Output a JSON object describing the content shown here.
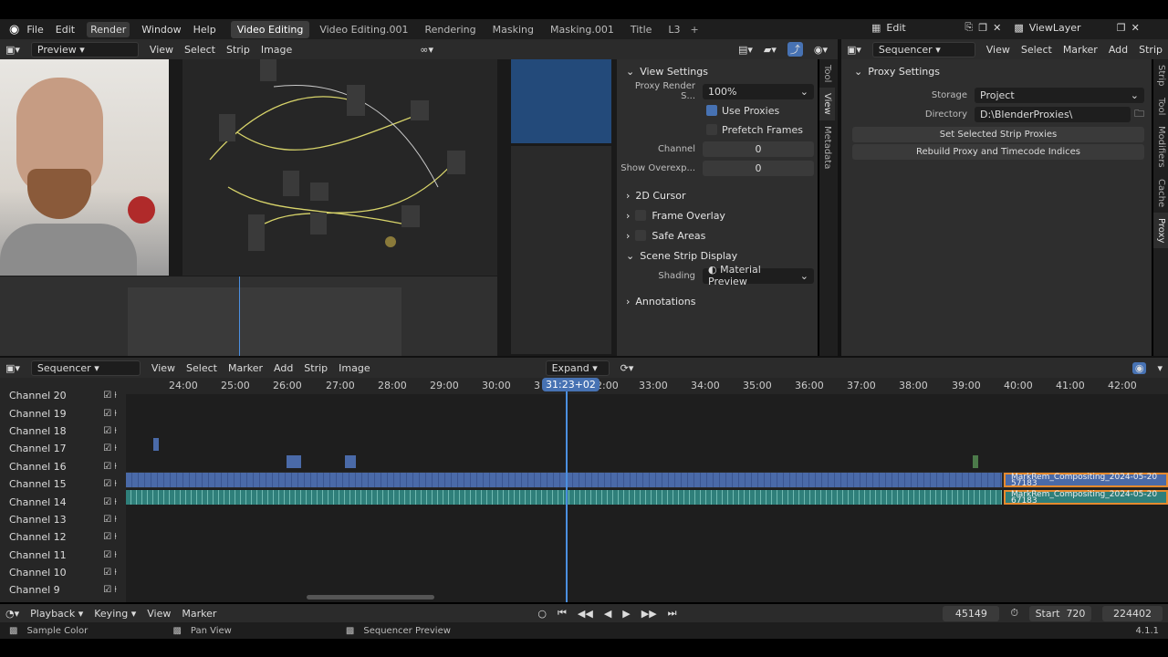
{
  "top_menu": {
    "items": [
      "File",
      "Edit",
      "Render",
      "Window",
      "Help"
    ],
    "workspaces": [
      "Video Editing",
      "Video Editing.001",
      "Rendering",
      "Masking",
      "Masking.001",
      "Title",
      "L3"
    ],
    "scene_mode": "Edit",
    "view_layer": "ViewLayer"
  },
  "preview": {
    "header_mode": "Preview",
    "menus": [
      "View",
      "Select",
      "Strip",
      "Image"
    ]
  },
  "sidebar_properties": {
    "tabs": [
      "Tool",
      "View",
      "Metadata"
    ],
    "view_settings": {
      "title": "View Settings",
      "proxy_render_label": "Proxy Render S...",
      "proxy_render_value": "100%",
      "use_proxies_label": "Use Proxies",
      "prefetch_label": "Prefetch Frames",
      "channel_label": "Channel",
      "channel_value": "0",
      "show_overexposed_label": "Show Overexp...",
      "show_overexposed_value": "0"
    },
    "panels": [
      "2D Cursor",
      "Frame Overlay",
      "Safe Areas"
    ],
    "scene_strip_display": {
      "title": "Scene Strip Display",
      "shading_label": "Shading",
      "shading_value": "Material Preview"
    },
    "annotations": "Annotations"
  },
  "proxy_panel": {
    "header_mode": "Sequencer",
    "menus": [
      "View",
      "Select",
      "Marker",
      "Add",
      "Strip"
    ],
    "title": "Proxy Settings",
    "storage_label": "Storage",
    "storage_value": "Project",
    "directory_label": "Directory",
    "directory_value": "D:\\BlenderProxies\\",
    "set_proxies_button": "Set Selected Strip Proxies",
    "rebuild_button": "Rebuild Proxy and Timecode Indices",
    "vtabs": [
      "Strip",
      "Tool",
      "Modifiers",
      "Cache",
      "Proxy"
    ]
  },
  "sequencer": {
    "header_mode": "Sequencer",
    "menus": [
      "View",
      "Select",
      "Marker",
      "Add",
      "Strip",
      "Image"
    ],
    "expand_label": "Expand",
    "timeline_labels": [
      "24:00",
      "25:00",
      "26:00",
      "27:00",
      "28:00",
      "29:00",
      "30:00",
      "3",
      "32:00",
      "33:00",
      "34:00",
      "35:00",
      "36:00",
      "37:00",
      "38:00",
      "39:00",
      "40:00",
      "41:00",
      "42:00"
    ],
    "current_time": "31:23+02",
    "channels": [
      "Channel 20",
      "Channel 19",
      "Channel 18",
      "Channel 17",
      "Channel 16",
      "Channel 15",
      "Channel 14",
      "Channel 13",
      "Channel 12",
      "Channel 11",
      "Channel 10",
      "Channel 9"
    ],
    "strip_label_a": "MarkRem_Compositing_2024-05-20",
    "strip_num_a": "57183",
    "strip_label_b": "MarkRem_Compositing_2024-05-20",
    "strip_num_b": "67183"
  },
  "playback_bar": {
    "playback": "Playback",
    "keying": "Keying",
    "view": "View",
    "marker": "Marker",
    "current_frame": "45149",
    "start_label": "Start",
    "start_value": "720",
    "end_value": "224402"
  },
  "status_bar": {
    "sample_color": "Sample Color",
    "pan_view": "Pan View",
    "sequencer_preview": "Sequencer Preview",
    "version": "4.1.1"
  },
  "colors": {
    "accent": "#4772b3",
    "strip_blue": "#4a6aa8",
    "strip_teal": "#2f7f7a",
    "playhead": "#4b8fe0",
    "selected": "#e68a2e"
  }
}
